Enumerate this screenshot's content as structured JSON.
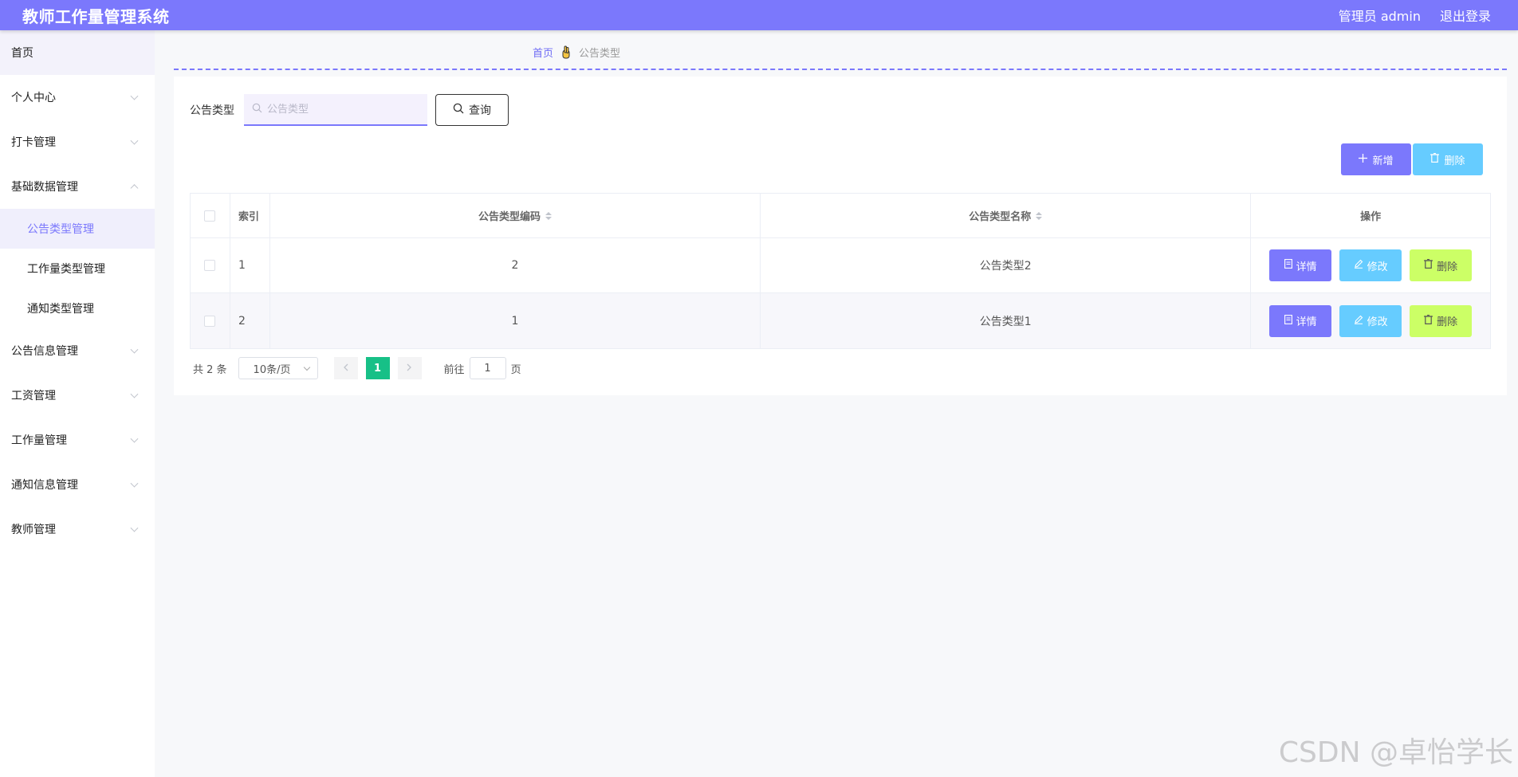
{
  "header": {
    "title": "教师工作量管理系统",
    "user": "管理员 admin",
    "logout": "退出登录"
  },
  "sidebar": {
    "items": [
      {
        "label": "首页"
      },
      {
        "label": "个人中心"
      },
      {
        "label": "打卡管理"
      },
      {
        "label": "基础数据管理"
      },
      {
        "label": "公告信息管理"
      },
      {
        "label": "工资管理"
      },
      {
        "label": "工作量管理"
      },
      {
        "label": "通知信息管理"
      },
      {
        "label": "教师管理"
      }
    ],
    "sub_items": [
      {
        "label": "公告类型管理"
      },
      {
        "label": "工作量类型管理"
      },
      {
        "label": "通知类型管理"
      }
    ]
  },
  "breadcrumb": {
    "home": "首页",
    "current": "公告类型"
  },
  "search": {
    "label": "公告类型",
    "placeholder": "公告类型",
    "button": "查询"
  },
  "toolbar": {
    "add": "新增",
    "delete": "删除"
  },
  "table": {
    "headers": {
      "index": "索引",
      "code": "公告类型编码",
      "name": "公告类型名称",
      "ops": "操作"
    },
    "rows": [
      {
        "index": "1",
        "code": "2",
        "name": "公告类型2"
      },
      {
        "index": "2",
        "code": "1",
        "name": "公告类型1"
      }
    ],
    "actions": {
      "detail": "详情",
      "edit": "修改",
      "delete": "删除"
    }
  },
  "pagination": {
    "total": "共 2 条",
    "page_size": "10条/页",
    "current": "1",
    "goto_prefix": "前往",
    "goto_value": "1",
    "goto_suffix": "页"
  },
  "watermark": "CSDN @卓怡学长",
  "colors": {
    "primary": "#7b78fc",
    "cyan": "#66ccff",
    "lime": "#ccff66",
    "pager_active": "#17c087"
  }
}
